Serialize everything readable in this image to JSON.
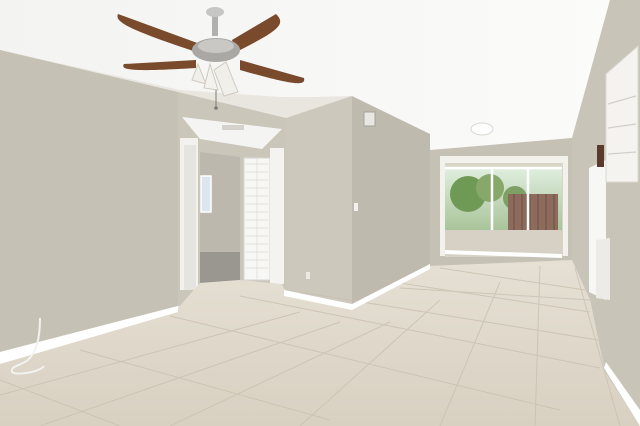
{
  "scene": {
    "fan_blade_color": "#7a4a2c",
    "wall_color": "#c9c4b8",
    "ceiling_color": "#f6f6f4",
    "floor_color": "#ddd6c8",
    "baseboard_color": "#ffffff"
  }
}
